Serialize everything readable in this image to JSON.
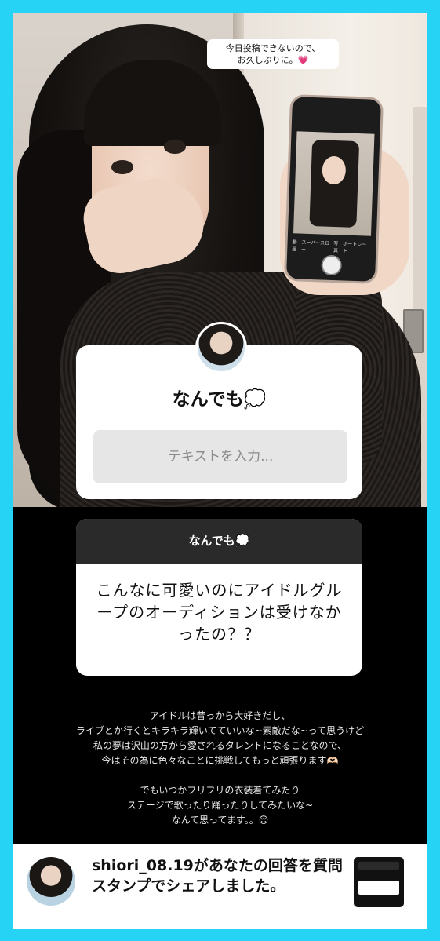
{
  "photo": {
    "caption_line1": "今日投稿できないので、",
    "caption_line2": "お久しぶりに。💗",
    "phone_modes": [
      "動画",
      "スーパースロー",
      "写真",
      "ポートレート"
    ]
  },
  "question_sticker": {
    "title": "なんでも💭",
    "input_placeholder": "テキストを入力..."
  },
  "answer_card": {
    "header": "なんでも💭",
    "question": "こんなに可愛いのにアイドルグループのオーディションは受けなかったの？？"
  },
  "reply": {
    "lines_1": [
      "アイドルは昔っから大好きだし、",
      "ライブとか行くとキラキラ輝いてていいな~素敵だな~って思うけど",
      "私の夢は沢山の方から愛されるタレントになることなので、",
      "今はその為に色々なことに挑戦してもっと頑張ります🫶🏻"
    ],
    "lines_2": [
      "でもいつかフリフリの衣装着てみたり",
      "ステージで歌ったり踊ったりしてみたいな~",
      "なんて思ってます。。😌"
    ]
  },
  "notification": {
    "text": "shiori_08.19があなたの回答を質問スタンプでシェアしました。"
  },
  "colors": {
    "border": "#27d3f5",
    "card_header": "#2a2a2a",
    "input_bg": "#e6e6e6"
  }
}
